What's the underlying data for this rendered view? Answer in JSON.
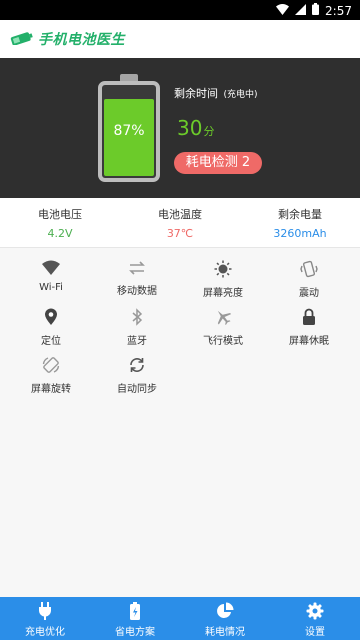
{
  "status_bar": {
    "time": "2:57"
  },
  "header": {
    "title": "手机电池医生"
  },
  "battery": {
    "percent_text": "87%",
    "level": 0.87,
    "remaining_label": "剩余时间",
    "remaining_sub": "(充电中)",
    "remaining_value": "30",
    "remaining_unit": "分",
    "check_button": "耗电检测 2"
  },
  "stats": [
    {
      "label": "电池电压",
      "value": "4.2V",
      "color": "#4caf50"
    },
    {
      "label": "电池温度",
      "value": "37℃",
      "color": "#ef6a67"
    },
    {
      "label": "剩余电量",
      "value": "3260mAh",
      "color": "#2b8ee8"
    }
  ],
  "toggles": [
    {
      "label": "Wi-Fi",
      "icon": "wifi-icon"
    },
    {
      "label": "移动数据",
      "icon": "mobile-data-icon"
    },
    {
      "label": "屏幕亮度",
      "icon": "brightness-icon"
    },
    {
      "label": "震动",
      "icon": "vibrate-icon"
    },
    {
      "label": "定位",
      "icon": "location-icon"
    },
    {
      "label": "蓝牙",
      "icon": "bluetooth-icon"
    },
    {
      "label": "飞行模式",
      "icon": "airplane-icon"
    },
    {
      "label": "屏幕休眠",
      "icon": "lock-icon"
    },
    {
      "label": "屏幕旋转",
      "icon": "rotate-icon"
    },
    {
      "label": "自动同步",
      "icon": "sync-icon"
    }
  ],
  "bottom_nav": [
    {
      "label": "充电优化",
      "icon": "plug-icon"
    },
    {
      "label": "省电方案",
      "icon": "battery-icon"
    },
    {
      "label": "耗电情况",
      "icon": "pie-chart-icon"
    },
    {
      "label": "设置",
      "icon": "gear-icon"
    }
  ],
  "colors": {
    "accent_green": "#6ccb2a",
    "brand_green": "#23b06a",
    "nav_blue": "#2b8ee8",
    "alert_red": "#ef6a67"
  }
}
